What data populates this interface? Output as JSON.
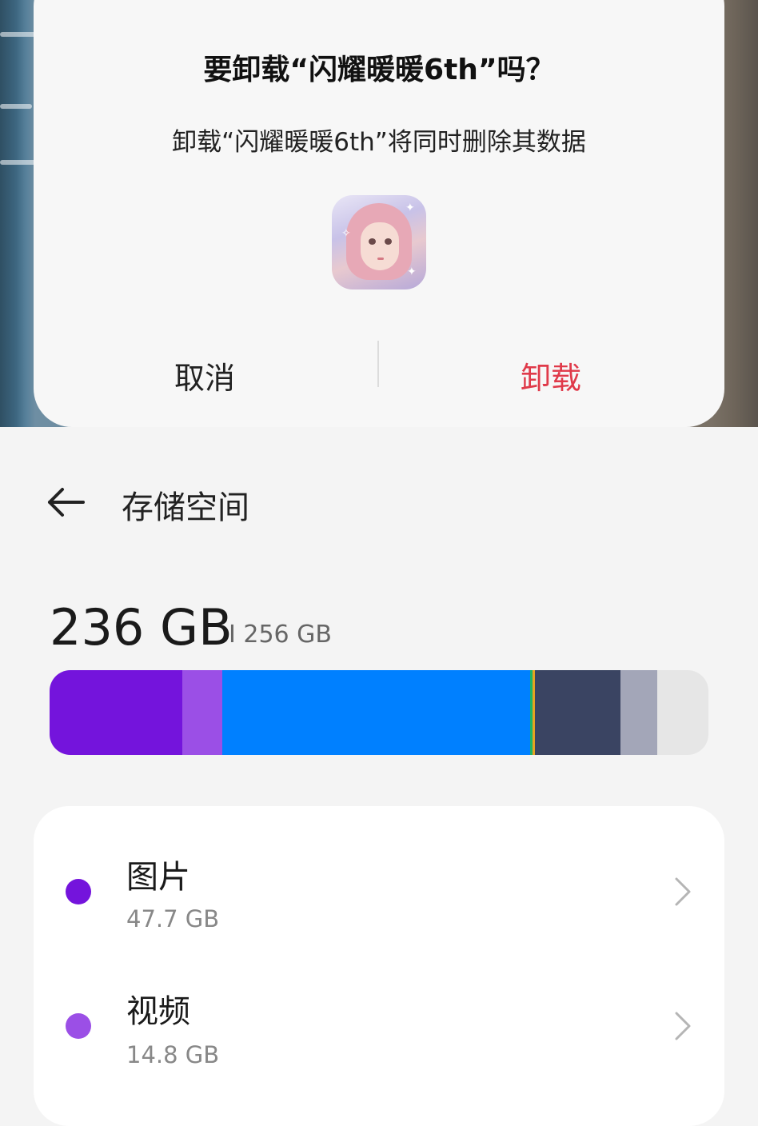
{
  "dialog": {
    "title": "要卸载“闪耀暖暖6th”吗？",
    "message": "卸载“闪耀暖暖6th”将同时删除其数据",
    "app_icon": "shining-nikki-app-icon",
    "cancel_label": "取消",
    "uninstall_label": "卸载",
    "uninstall_color": "#e03a4a"
  },
  "header": {
    "back_icon": "arrow-left-icon",
    "title": "存储空间"
  },
  "storage": {
    "used": "236 GB",
    "total": "I 256 GB",
    "used_fraction": 0.92,
    "segments": [
      {
        "color": "#7414dc",
        "fraction": 0.202
      },
      {
        "color": "#9b4fe6",
        "fraction": 0.061
      },
      {
        "color": "#0080ff",
        "fraction": 0.467
      },
      {
        "color": "#1bb36b",
        "fraction": 0.004
      },
      {
        "color": "#e6a321",
        "fraction": 0.004
      },
      {
        "color": "#3a4462",
        "fraction": 0.13
      },
      {
        "color": "#a3a6b8",
        "fraction": 0.056
      }
    ],
    "free_color": "#e6e6e6"
  },
  "categories": [
    {
      "name": "图片",
      "size": "47.7 GB",
      "color": "#7414dc"
    },
    {
      "name": "视频",
      "size": "14.8 GB",
      "color": "#9b4fe6"
    }
  ]
}
